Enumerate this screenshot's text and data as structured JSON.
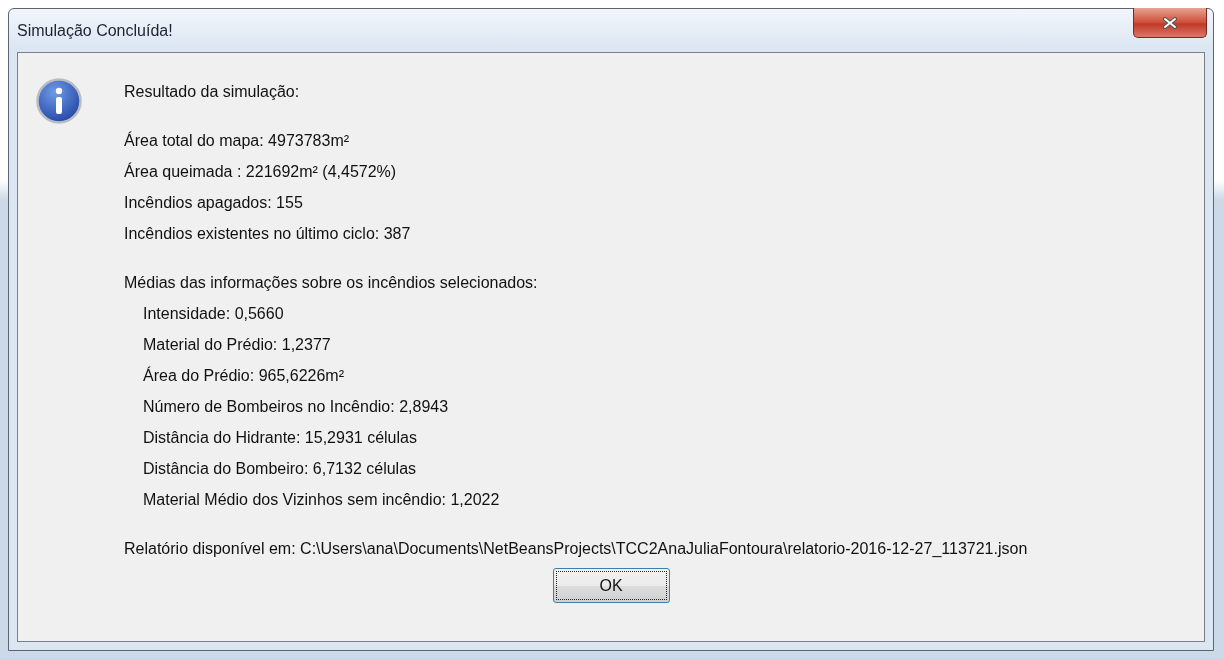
{
  "window": {
    "title": "Simulação Concluída!"
  },
  "message": {
    "heading": "Resultado da simulação:",
    "summary": [
      "Área total do mapa: 4973783m²",
      "Área queimada : 221692m² (4,4572%)",
      "Incêndios apagados: 155",
      "Incêndios existentes no último ciclo: 387"
    ],
    "averages_heading": "Médias das informações sobre os incêndios selecionados:",
    "averages": [
      "Intensidade: 0,5660",
      "Material do Prédio: 1,2377",
      "Área do Prédio: 965,6226m²",
      "Número de Bombeiros no Incêndio: 2,8943",
      "Distância do Hidrante: 15,2931 células",
      "Distância do Bombeiro: 6,7132 células",
      "Material Médio dos Vizinhos sem incêndio: 1,2022"
    ],
    "report": "Relatório disponível em: C:\\Users\\ana\\Documents\\NetBeansProjects\\TCC2AnaJuliaFontoura\\relatorio-2016-12-27_113721.json"
  },
  "buttons": [
    "OK"
  ]
}
